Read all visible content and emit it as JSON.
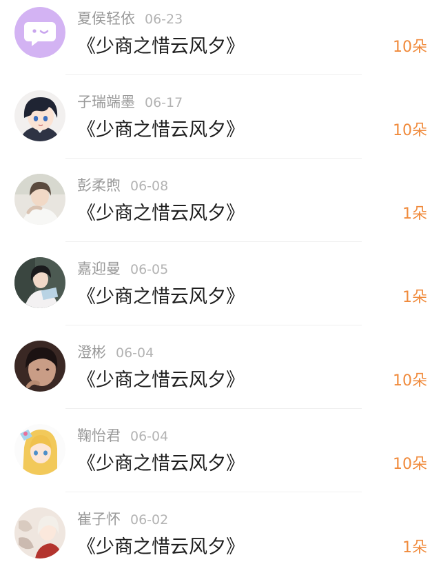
{
  "accent_color": "#f08a3b",
  "entries": [
    {
      "name": "夏侯轻依",
      "date": "06-23",
      "title": "《少商之惜云风夕》",
      "count": "10朵",
      "avatar_icon": "chat-bubble-avatar-icon"
    },
    {
      "name": "子瑞端墨",
      "date": "06-17",
      "title": "《少商之惜云风夕》",
      "count": "10朵",
      "avatar_icon": "anime-boy-avatar"
    },
    {
      "name": "彭柔煦",
      "date": "06-08",
      "title": "《少商之惜云风夕》",
      "count": "1朵",
      "avatar_icon": "photo-avatar"
    },
    {
      "name": "嘉迎曼",
      "date": "06-05",
      "title": "《少商之惜云风夕》",
      "count": "1朵",
      "avatar_icon": "photo-avatar"
    },
    {
      "name": "澄彬",
      "date": "06-04",
      "title": "《少商之惜云风夕》",
      "count": "10朵",
      "avatar_icon": "photo-avatar"
    },
    {
      "name": "鞠怡君",
      "date": "06-04",
      "title": "《少商之惜云风夕》",
      "count": "10朵",
      "avatar_icon": "anime-girl-avatar"
    },
    {
      "name": "崔子怀",
      "date": "06-02",
      "title": "《少商之惜云风夕》",
      "count": "1朵",
      "avatar_icon": "anime-girl-avatar"
    }
  ]
}
